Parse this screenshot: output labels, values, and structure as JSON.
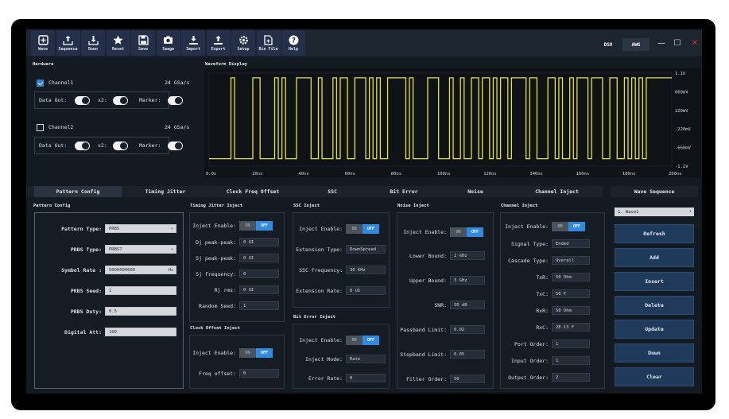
{
  "toolbar": {
    "buttons": [
      {
        "label": "Wave",
        "icon": "plus-square-icon"
      },
      {
        "label": "Sequence",
        "icon": "upload-tray-icon"
      },
      {
        "label": "Down",
        "icon": "download-tray-icon"
      },
      {
        "label": "Reset",
        "icon": "star-icon"
      },
      {
        "label": "Save",
        "icon": "floppy-icon"
      },
      {
        "label": "Image",
        "icon": "camera-icon"
      },
      {
        "label": "Import",
        "icon": "import-arrow-icon"
      },
      {
        "label": "Export",
        "icon": "export-arrow-icon"
      },
      {
        "label": "Setup",
        "icon": "gear-icon"
      },
      {
        "label": "Bin File",
        "icon": "file-icon"
      },
      {
        "label": "Help",
        "icon": "help-icon"
      }
    ],
    "mode_dso": "DSO",
    "mode_awg": "AWG",
    "minimize": "—",
    "maximize": "☐",
    "close": "✕"
  },
  "hardware": {
    "title": "Hardware",
    "channel1": {
      "label": "Channel1",
      "rate": "24 GSa/s",
      "checked": true
    },
    "channel2": {
      "label": "Channel2",
      "rate": "24 GSa/s",
      "checked": false
    },
    "data_out": "Data Out:",
    "x2": "x2:",
    "marker": "Marker:"
  },
  "waveform": {
    "title": "Waveform Display",
    "y_labels": [
      "1.1V",
      "660mV",
      "220mV",
      "-220mV",
      "-660mV",
      "-1.1V"
    ],
    "x_labels": [
      "0.0s",
      "20ns",
      "40ns",
      "60ns",
      "80ns",
      "100ns",
      "120ns",
      "140ns",
      "160ns",
      "180ns",
      "200ns"
    ],
    "color": "#e6e61e"
  },
  "tabs": [
    "Pattern Config",
    "Timing Jitter",
    "Clock Freq Offset",
    "SSC",
    "Bit Error",
    "Noise",
    "Channel Inject"
  ],
  "pattern": {
    "title": "Pattern Config",
    "fields": [
      {
        "label": "Pattern Type:",
        "value": "PRBS"
      },
      {
        "label": "PRBS Type:",
        "value": "PRBS7"
      },
      {
        "label": "Symbol Rate :",
        "value": "5000000000",
        "unit": "Hz"
      },
      {
        "label": "PRBS Seed:",
        "value": "1"
      },
      {
        "label": "PRBS Duty:",
        "value": "0.5"
      },
      {
        "label": "Digital Att:",
        "value": "100"
      }
    ]
  },
  "switch": {
    "on": "ON",
    "off": "OFF"
  },
  "jitter": {
    "title": "Timing Jitter Inject",
    "enable": "Inject Enable:",
    "fields": [
      {
        "label": "Dj peak-peak:",
        "value": "0 UI"
      },
      {
        "label": "Sj peak-peak:",
        "value": "0 UI"
      },
      {
        "label": "Sj frequency:",
        "value": "0"
      },
      {
        "label": "Rj rms:",
        "value": "0 UI"
      },
      {
        "label": "Random Seed:",
        "value": "1"
      }
    ]
  },
  "clock": {
    "title": "Clock Offset Inject",
    "enable": "Inject Enable:",
    "freq_label": "Freq offset:",
    "freq_value": "0"
  },
  "ssc": {
    "title": "SSC Inject",
    "enable": "Inject Enable:",
    "fields": [
      {
        "label": "Extension Type:",
        "value": "DownSpread"
      },
      {
        "label": "SSC Frequency:",
        "value": "30 KHz"
      },
      {
        "label": "Extension Rate:",
        "value": "0 UI"
      }
    ]
  },
  "biterror": {
    "title": "Bit Error Inject",
    "enable": "Inject Enable:",
    "fields": [
      {
        "label": "Inject Mode:",
        "value": "Rate"
      },
      {
        "label": "Error Rate:",
        "value": "0"
      }
    ]
  },
  "noise": {
    "title": "Noise Inject",
    "enable": "Inject Enable:",
    "fields": [
      {
        "label": "Lower Bound:",
        "value": "2 GHz"
      },
      {
        "label": "Upper Bound:",
        "value": "3 GHz"
      },
      {
        "label": "SNR:",
        "value": "50 dB"
      },
      {
        "label": "Passband Limit:",
        "value": "0.02"
      },
      {
        "label": "Stopband Limit:",
        "value": "0.05"
      },
      {
        "label": "Filter Order:",
        "value": "50"
      }
    ]
  },
  "channel": {
    "title": "Channel Inject",
    "enable": "Inject Enable:",
    "fields": [
      {
        "label": "Signal Type:",
        "value": "Ended"
      },
      {
        "label": "Cascade Type:",
        "value": "Overall"
      },
      {
        "label": "TxR:",
        "value": "50 Ohm"
      },
      {
        "label": "TxC:",
        "value": "50 F"
      },
      {
        "label": "RxR:",
        "value": "50 Ohm"
      },
      {
        "label": "RxC:",
        "value": "2E-13 F"
      },
      {
        "label": "Port Order:",
        "value": "1"
      },
      {
        "label": "Input Order:",
        "value": "1"
      },
      {
        "label": "Output Order:",
        "value": "2"
      }
    ]
  },
  "sequence": {
    "title": "Wave Sequence",
    "selected": "1. Wave1",
    "buttons": [
      "Refresh",
      "Add",
      "Insert",
      "Delete",
      "Update",
      "Down",
      "Clear"
    ]
  }
}
